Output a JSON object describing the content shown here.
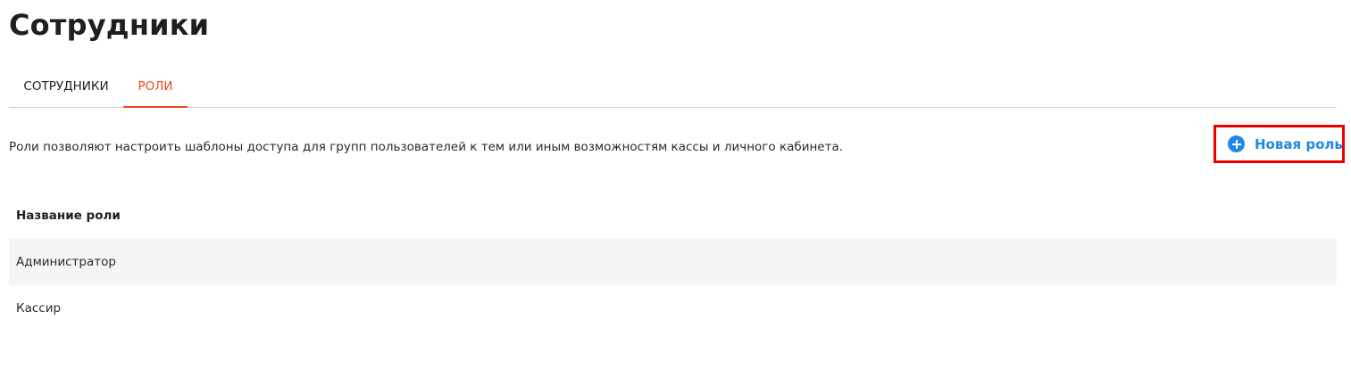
{
  "page": {
    "title": "Сотрудники"
  },
  "tabs": [
    {
      "label": "СОТРУДНИКИ",
      "active": false
    },
    {
      "label": "РОЛИ",
      "active": true
    }
  ],
  "roles_section": {
    "description": "Роли позволяют настроить шаблоны доступа для групп пользователей к тем или иным возможностям кассы и личного кабинета.",
    "new_role_button": {
      "label": "Новая роль",
      "icon": "plus-circle-icon"
    }
  },
  "table": {
    "header": "Название роли",
    "rows": [
      {
        "name": "Администратор"
      },
      {
        "name": "Кассир"
      }
    ]
  },
  "colors": {
    "accent": "#e8491d",
    "link_blue": "#1f88e5",
    "highlight_border": "#ee0000",
    "row_stripe": "#f4f5f7"
  }
}
